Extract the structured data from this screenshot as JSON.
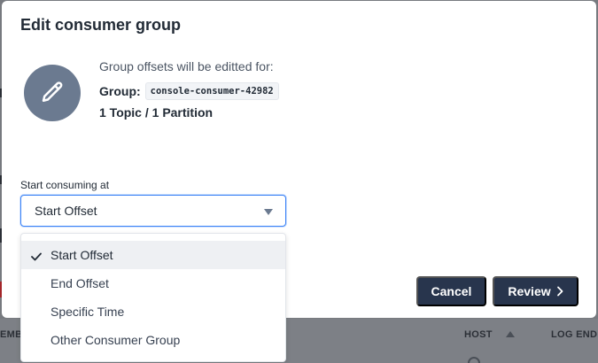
{
  "background": {
    "columns": [
      "EMBE",
      "HOST",
      "LOG END"
    ]
  },
  "modal": {
    "title": "Edit consumer group",
    "info_line": "Group offsets will be editted for:",
    "group_label": "Group:",
    "group_name": "console-consumer-42982",
    "topic_summary": "1 Topic / 1 Partition",
    "avatar_icon": "pencil-icon",
    "field_label": "Start consuming at",
    "selected_value": "Start Offset",
    "options": [
      {
        "label": "Start Offset",
        "selected": true
      },
      {
        "label": "End Offset",
        "selected": false
      },
      {
        "label": "Specific Time",
        "selected": false
      },
      {
        "label": "Other Consumer Group",
        "selected": false
      }
    ],
    "cancel_label": "Cancel",
    "review_label": "Review"
  },
  "colors": {
    "primary_button": "#28354d",
    "focus_border": "#3b82f6",
    "avatar": "#6b7a90"
  }
}
